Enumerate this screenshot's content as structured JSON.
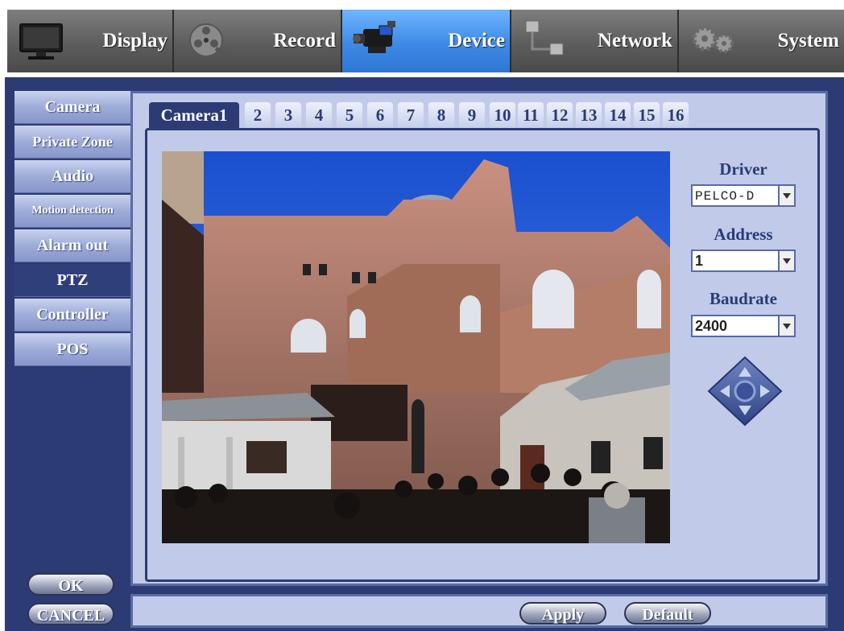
{
  "top_menu": [
    {
      "label": "Display",
      "icon": "monitor-icon",
      "active": false
    },
    {
      "label": "Record",
      "icon": "film-reel-icon",
      "active": false
    },
    {
      "label": "Device",
      "icon": "camcorder-icon",
      "active": true
    },
    {
      "label": "Network",
      "icon": "network-icon",
      "active": false
    },
    {
      "label": "System",
      "icon": "gears-icon",
      "active": false
    }
  ],
  "side_menu": [
    {
      "label": "Camera",
      "active": false
    },
    {
      "label": "Private Zone",
      "active": false
    },
    {
      "label": "Audio",
      "active": false
    },
    {
      "label": "Motion detection",
      "active": false
    },
    {
      "label": "Alarm out",
      "active": false
    },
    {
      "label": "PTZ",
      "active": true
    },
    {
      "label": "Controller",
      "active": false
    },
    {
      "label": "POS",
      "active": false
    }
  ],
  "camera_tabs": [
    "Camera1",
    "2",
    "3",
    "4",
    "5",
    "6",
    "7",
    "8",
    "9",
    "10",
    "11",
    "12",
    "13",
    "14",
    "15",
    "16"
  ],
  "ptz": {
    "driver_label": "Driver",
    "driver_value": "PELCO-D",
    "address_label": "Address",
    "address_value": "1",
    "baudrate_label": "Baudrate",
    "baudrate_value": "2400",
    "direction_pad_icon": "ptz-direction-pad-icon"
  },
  "buttons": {
    "ok": "OK",
    "cancel": "CANCEL",
    "apply": "Apply",
    "default": "Default"
  },
  "colors": {
    "active_top_tab": "#3d8ae6",
    "frame": "#2c3b73",
    "panel": "#c1cbe9"
  }
}
